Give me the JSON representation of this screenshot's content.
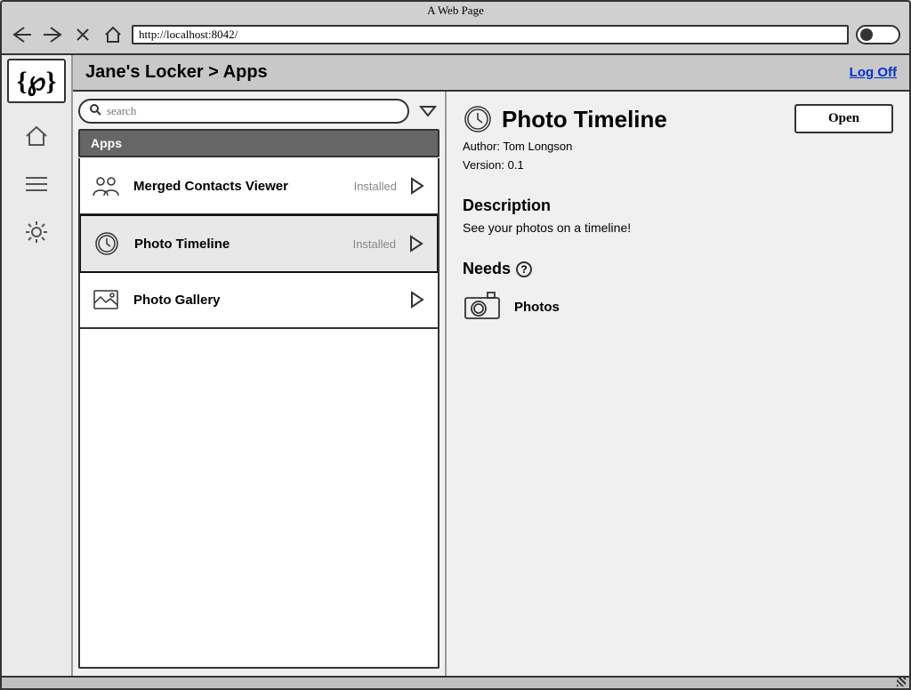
{
  "browser": {
    "title": "A Web Page",
    "url": "http://localhost:8042/"
  },
  "breadcrumb": "Jane's Locker > Apps",
  "logoff_label": "Log Off",
  "logo_text": "{℘}",
  "search": {
    "placeholder": "search"
  },
  "section_header": "Apps",
  "apps": [
    {
      "name": "Merged Contacts Viewer",
      "status": "Installed",
      "icon": "contacts"
    },
    {
      "name": "Photo Timeline",
      "status": "Installed",
      "icon": "clock"
    },
    {
      "name": "Photo Gallery",
      "status": "",
      "icon": "gallery"
    }
  ],
  "detail": {
    "title": "Photo Timeline",
    "author_label": "Author:",
    "author": "Tom Longson",
    "version_label": "Version:",
    "version": "0.1",
    "open_label": "Open",
    "description_heading": "Description",
    "description": "See your photos on a timeline!",
    "needs_heading": "Needs",
    "needs_item": "Photos"
  }
}
